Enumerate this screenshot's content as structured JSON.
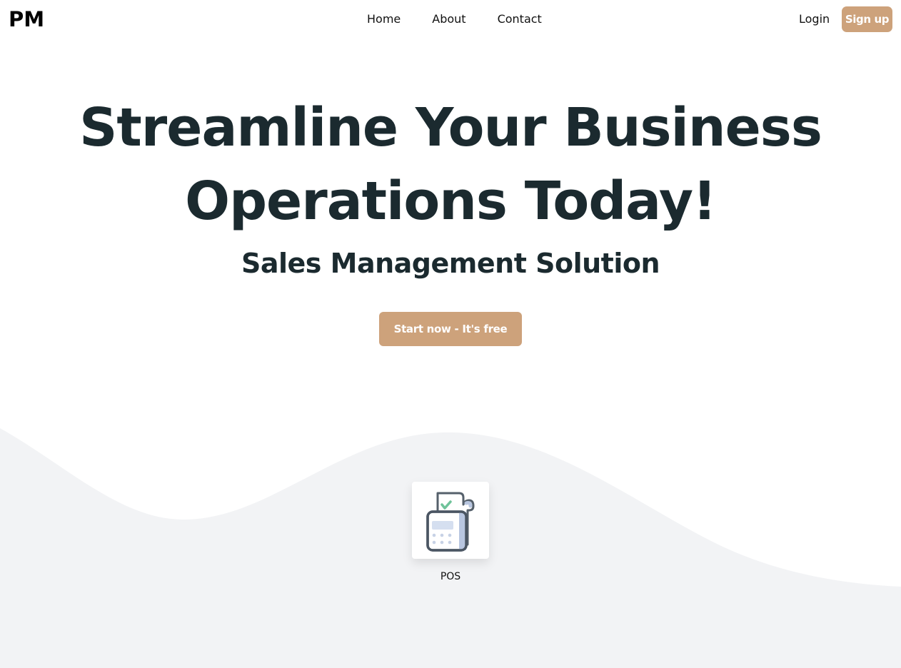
{
  "nav": {
    "brand": "PM",
    "links": [
      "Home",
      "About",
      "Contact"
    ],
    "login": "Login",
    "signup": "Sign up"
  },
  "hero": {
    "title_line1": "Streamline Your Business",
    "title_line2": "Operations Today!",
    "subtitle": "Sales Management Solution",
    "cta": "Start now - It's free"
  },
  "apps": [
    {
      "label": "POS",
      "icon": "pos-terminal-icon"
    }
  ],
  "colors": {
    "accent": "#cda27b",
    "heading": "#1b2a2f",
    "wave_bg": "#f2f3f5"
  }
}
